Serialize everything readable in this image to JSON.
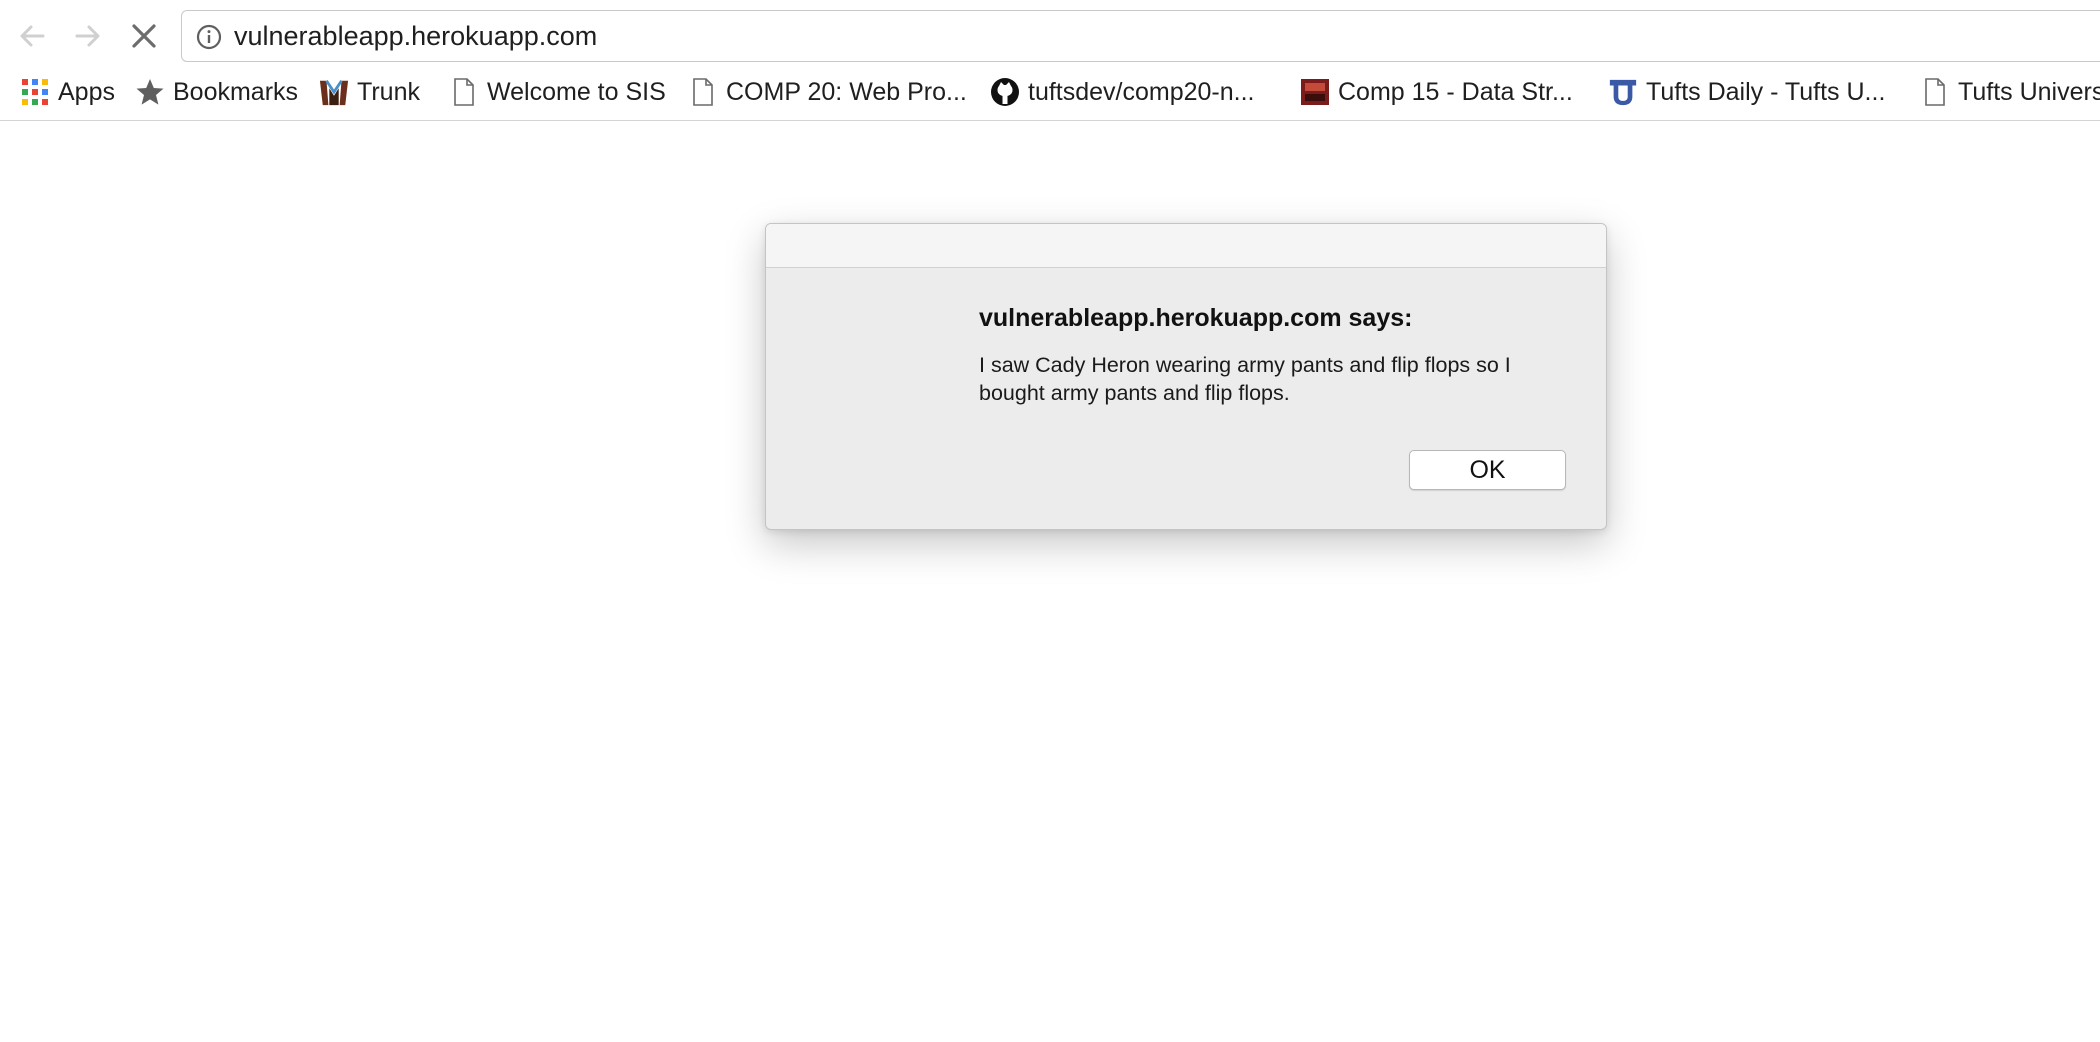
{
  "browser": {
    "url": "vulnerableapp.herokuapp.com",
    "nav": {
      "back_icon": "back-arrow-icon",
      "forward_icon": "forward-arrow-icon",
      "stop_icon": "stop-loading-icon"
    }
  },
  "bookmarks": {
    "items": [
      {
        "label": "Apps",
        "icon": "apps-grid-icon"
      },
      {
        "label": "Bookmarks",
        "icon": "star-icon"
      },
      {
        "label": "Trunk",
        "icon": "trunk-icon"
      },
      {
        "label": "Welcome to SIS",
        "icon": "page-icon"
      },
      {
        "label": "COMP 20: Web Pro...",
        "icon": "page-icon"
      },
      {
        "label": "tuftsdev/comp20-n...",
        "icon": "github-icon"
      },
      {
        "label": "Comp 15 - Data Str...",
        "icon": "comp15-favicon"
      },
      {
        "label": "Tufts Daily - Tufts U...",
        "icon": "tufts-daily-icon"
      },
      {
        "label": "Tufts Univers",
        "icon": "page-icon"
      }
    ]
  },
  "dialog": {
    "title": "vulnerableapp.herokuapp.com says:",
    "message": "I saw Cady Heron wearing army pants and flip flops so I bought army pants and flip flops.",
    "ok_label": "OK"
  },
  "colors": {
    "dialog_bg": "#ececec",
    "dialog_titlebar": "#f5f5f5",
    "page_bg": "#ffffff",
    "github_black": "#111111",
    "tufts_blue": "#3b5aa6"
  }
}
